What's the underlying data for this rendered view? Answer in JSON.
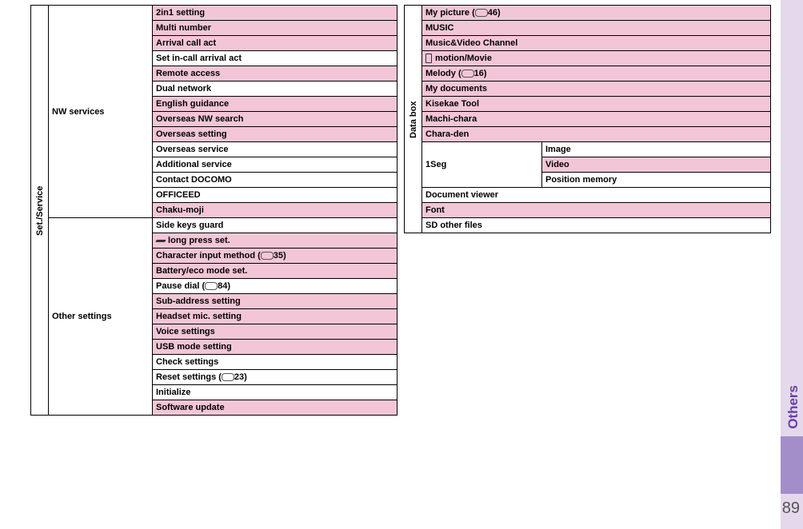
{
  "page": {
    "number": "89",
    "section": "Others"
  },
  "left_table": {
    "vert_header": "Set./Service",
    "groups": [
      {
        "label": "NW services",
        "rows": [
          {
            "text": "2in1 setting",
            "shade": "pink"
          },
          {
            "text": "Multi number",
            "shade": "pink"
          },
          {
            "text": "Arrival call act",
            "shade": "pink"
          },
          {
            "text": "Set in-call arrival act",
            "shade": "white"
          },
          {
            "text": "Remote access",
            "shade": "pink"
          },
          {
            "text": "Dual network",
            "shade": "white"
          },
          {
            "text": "English guidance",
            "shade": "pink"
          },
          {
            "text": "Overseas NW search",
            "shade": "pink"
          },
          {
            "text": "Overseas setting",
            "shade": "pink"
          },
          {
            "text": "Overseas service",
            "shade": "white"
          },
          {
            "text": "Additional service",
            "shade": "white"
          },
          {
            "text": "Contact DOCOMO",
            "shade": "white"
          },
          {
            "text": "OFFICEED",
            "shade": "white"
          },
          {
            "text": "Chaku-moji",
            "shade": "pink"
          }
        ]
      },
      {
        "label": "Other settings",
        "rows": [
          {
            "text": "Side keys guard",
            "shade": "white"
          },
          {
            "text": "long press set.",
            "shade": "pink",
            "icon": "slash"
          },
          {
            "text_before": "Character input method (",
            "text_after": "35)",
            "shade": "pink",
            "icon": "menu"
          },
          {
            "text": "Battery/eco mode set.",
            "shade": "pink"
          },
          {
            "text_before": "Pause dial (",
            "text_after": "84)",
            "shade": "white",
            "icon": "menu"
          },
          {
            "text": "Sub-address setting",
            "shade": "pink"
          },
          {
            "text": "Headset mic. setting",
            "shade": "pink"
          },
          {
            "text": "Voice settings",
            "shade": "pink"
          },
          {
            "text": "USB mode setting",
            "shade": "pink"
          },
          {
            "text": "Check settings",
            "shade": "white"
          },
          {
            "text_before": "Reset settings (",
            "text_after": "23)",
            "shade": "white",
            "icon": "menu"
          },
          {
            "text": "Initialize",
            "shade": "white"
          },
          {
            "text": "Software update",
            "shade": "pink"
          }
        ]
      }
    ]
  },
  "right_table": {
    "vert_header": "Data box",
    "rows_simple": [
      {
        "text_before": "My picture (",
        "text_after": "46)",
        "shade": "pink",
        "icon": "menu"
      },
      {
        "text": "MUSIC",
        "shade": "pink"
      },
      {
        "text": "Music&Video Channel",
        "shade": "pink"
      },
      {
        "text": "motion/Movie",
        "shade": "pink",
        "icon": "phone"
      },
      {
        "text_before": "Melody (",
        "text_after": "16)",
        "shade": "pink",
        "icon": "menu"
      },
      {
        "text": "My documents",
        "shade": "pink"
      },
      {
        "text": "Kisekae Tool",
        "shade": "pink"
      },
      {
        "text": "Machi-chara",
        "shade": "pink"
      },
      {
        "text": "Chara-den",
        "shade": "pink"
      }
    ],
    "group_1seg": {
      "label": "1Seg",
      "rows": [
        {
          "text": "Image",
          "shade": "white"
        },
        {
          "text": "Video",
          "shade": "pink"
        },
        {
          "text": "Position memory",
          "shade": "white"
        }
      ]
    },
    "rows_after": [
      {
        "text": "Document viewer",
        "shade": "white"
      },
      {
        "text": "Font",
        "shade": "pink"
      },
      {
        "text": "SD other files",
        "shade": "white"
      }
    ]
  }
}
